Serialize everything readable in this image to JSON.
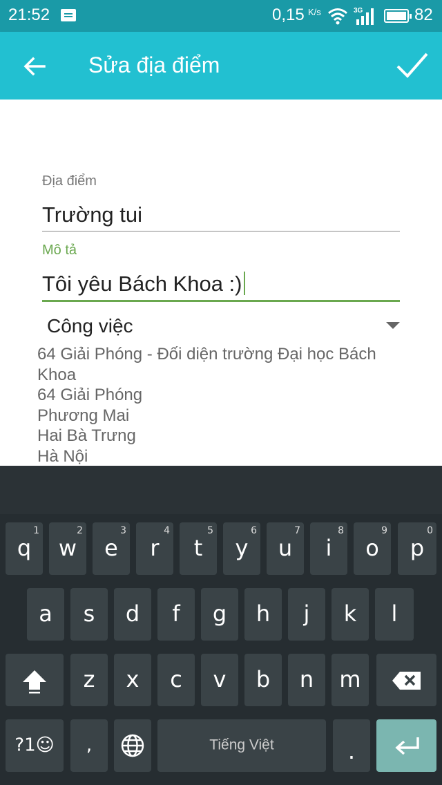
{
  "status_bar": {
    "time": "21:52",
    "speed": "0,15",
    "speed_unit": "K/s",
    "network": "3G",
    "battery": "82"
  },
  "app_bar": {
    "title": "Sửa địa điểm",
    "back_icon": "arrow-left-icon",
    "confirm_icon": "check-icon",
    "color": "#22c0d1"
  },
  "form": {
    "place_label": "Địa điểm",
    "place_value": "Trường tui",
    "desc_label": "Mô tả",
    "desc_value": "Tôi yêu Bách Khoa :)",
    "category": "Công việc",
    "address_lines": [
      "64 Giải Phóng - Đối diện trường Đại học Bách",
      "Khoa",
      "64 Giải Phóng",
      "Phương Mai",
      "Hai Bà Trưng",
      "Hà Nội"
    ],
    "accent_color": "#6aa84f"
  },
  "keyboard": {
    "row1": [
      {
        "key": "q",
        "hint": "1"
      },
      {
        "key": "w",
        "hint": "2"
      },
      {
        "key": "e",
        "hint": "3"
      },
      {
        "key": "r",
        "hint": "4"
      },
      {
        "key": "t",
        "hint": "5"
      },
      {
        "key": "y",
        "hint": "6"
      },
      {
        "key": "u",
        "hint": "7"
      },
      {
        "key": "i",
        "hint": "8"
      },
      {
        "key": "o",
        "hint": "9"
      },
      {
        "key": "p",
        "hint": "0"
      }
    ],
    "row2": [
      "a",
      "s",
      "d",
      "f",
      "g",
      "h",
      "j",
      "k",
      "l"
    ],
    "row3": [
      "z",
      "x",
      "c",
      "v",
      "b",
      "n",
      "m"
    ],
    "symbols_key": "?1☺",
    "comma_key": ",",
    "space_label": "Tiếng Việt",
    "period_key": "."
  }
}
